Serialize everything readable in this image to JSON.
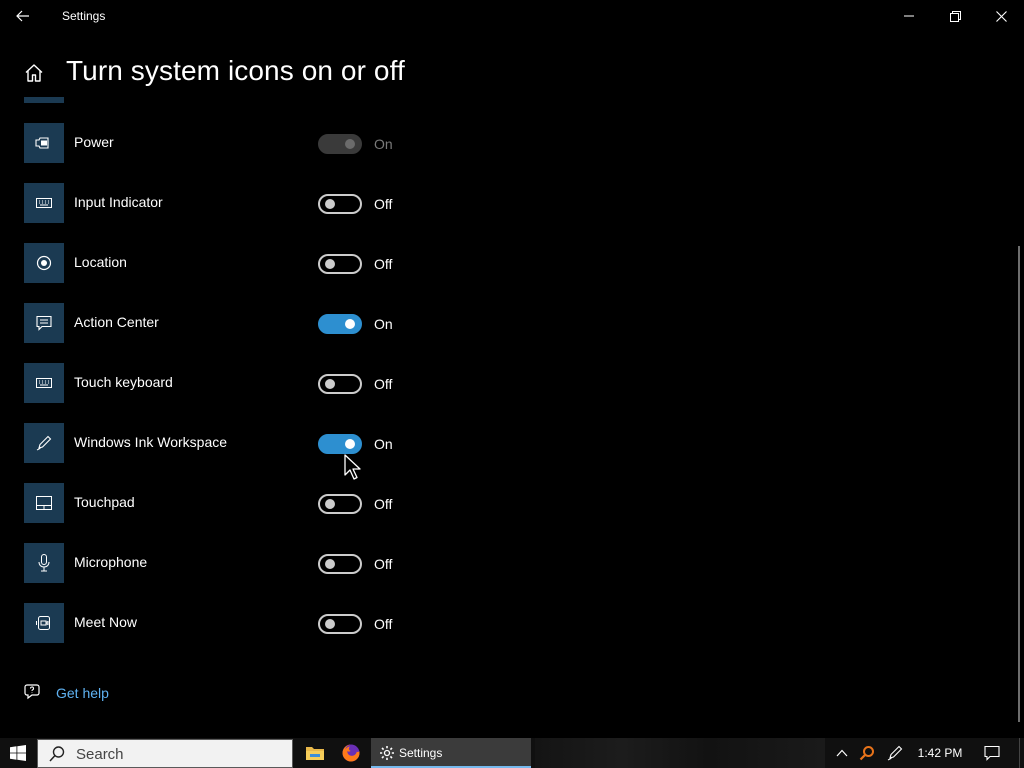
{
  "window": {
    "title": "Settings",
    "back_icon": "back-arrow-icon",
    "controls": [
      "minimize-icon",
      "maximize-icon",
      "close-icon"
    ]
  },
  "header": {
    "home_icon": "home-icon",
    "title": "Turn system icons on or off"
  },
  "colors": {
    "background": "#000000",
    "tile": "#1b3a52",
    "accent": "#2d8fd0",
    "link": "#5fb2f2"
  },
  "items": [
    {
      "label": "Power",
      "icon": "battery-icon",
      "state": "On",
      "on": true,
      "disabled": true
    },
    {
      "label": "Input Indicator",
      "icon": "keyboard-icon",
      "state": "Off",
      "on": false,
      "disabled": false
    },
    {
      "label": "Location",
      "icon": "location-icon",
      "state": "Off",
      "on": false,
      "disabled": false
    },
    {
      "label": "Action Center",
      "icon": "action-center-icon",
      "state": "On",
      "on": true,
      "disabled": false
    },
    {
      "label": "Touch keyboard",
      "icon": "keyboard-icon",
      "state": "Off",
      "on": false,
      "disabled": false
    },
    {
      "label": "Windows Ink Workspace",
      "icon": "pen-icon",
      "state": "On",
      "on": true,
      "disabled": false
    },
    {
      "label": "Touchpad",
      "icon": "touchpad-icon",
      "state": "Off",
      "on": false,
      "disabled": false
    },
    {
      "label": "Microphone",
      "icon": "microphone-icon",
      "state": "Off",
      "on": false,
      "disabled": false
    },
    {
      "label": "Meet Now",
      "icon": "meet-now-icon",
      "state": "Off",
      "on": false,
      "disabled": false
    }
  ],
  "help": {
    "icon": "help-chat-icon",
    "label": "Get help"
  },
  "taskbar": {
    "start_icon": "windows-logo-icon",
    "search_placeholder": "Search",
    "pinned": [
      "file-explorer-icon",
      "firefox-icon"
    ],
    "active_app_label": "Settings",
    "tray_icons": [
      "chevron-up-icon",
      "search-tray-icon",
      "pen-tray-icon",
      "notification-icon"
    ],
    "clock": "1:42 PM"
  }
}
